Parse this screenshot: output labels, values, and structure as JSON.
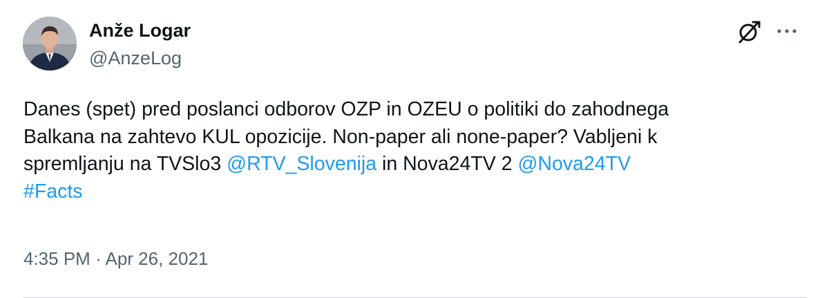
{
  "author": {
    "display_name": "Anže Logar",
    "handle": "@AnzeLog",
    "avatar_icon": "person-avatar"
  },
  "header_icons": {
    "brand_icon": "x-logo-icon",
    "more_icon": "more-options-icon"
  },
  "tweet": {
    "line1": "Danes (spet) pred poslanci odborov OZP in OZEU o politiki do zahodnega",
    "line2": "Balkana na zahtevo KUL opozicije. Non-paper ali none-paper? Vabljeni k",
    "line3_prefix": "spremljanju na TVSlo3 ",
    "mention1": "@RTV_Slovenija",
    "line3_middle": " in Nova24TV 2 ",
    "mention2": "@Nova24TV",
    "hashtag": "#Facts"
  },
  "timestamp": "4:35 PM · Apr 26, 2021",
  "colors": {
    "text": "#0f1419",
    "secondary": "#536471",
    "link": "#1d9bf0",
    "divider": "#cfd9de"
  }
}
